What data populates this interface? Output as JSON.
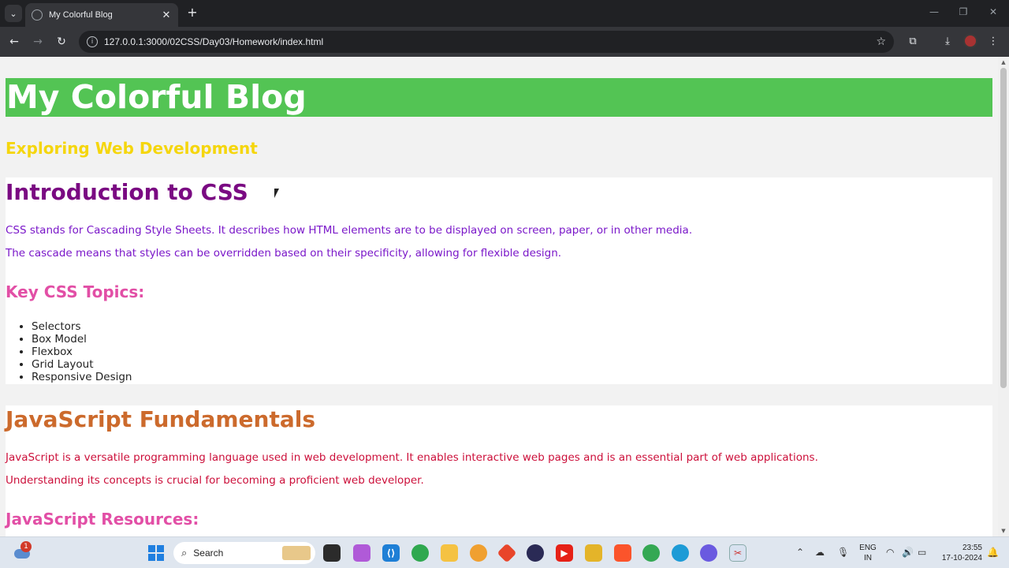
{
  "browser": {
    "tab_title": "My Colorful Blog",
    "url": "127.0.0.1:3000/02CSS/Day03/Homework/index.html"
  },
  "page": {
    "blog_title": "My Colorful Blog",
    "blog_subtitle": "Exploring Web Development",
    "css_section": {
      "title": "Introduction to CSS",
      "paragraphs": [
        "CSS stands for Cascading Style Sheets. It describes how HTML elements are to be displayed on screen, paper, or in other media.",
        "The cascade means that styles can be overridden based on their specificity, allowing for flexible design."
      ],
      "subheading": "Key CSS Topics:",
      "topics": [
        "Selectors",
        "Box Model",
        "Flexbox",
        "Grid Layout",
        "Responsive Design"
      ]
    },
    "js_section": {
      "title": "JavaScript Fundamentals",
      "paragraphs": [
        "JavaScript is a versatile programming language used in web development. It enables interactive web pages and is an essential part of web applications.",
        "Understanding its concepts is crucial for becoming a proficient web developer."
      ],
      "subheading": "JavaScript Resources:"
    },
    "colors": {
      "header_bg": "#53c454",
      "subtitle": "#f5d60e",
      "css_title": "#7a0a82",
      "css_text": "#7a17c9",
      "subheading": "#e24fa6",
      "js_title": "#cc6a2c",
      "js_text": "#cc0f3a"
    }
  },
  "taskbar": {
    "weather_badge": "1",
    "search_label": "Search",
    "language": "ENG",
    "region": "IN",
    "time": "23:55",
    "date": "17-10-2024"
  }
}
